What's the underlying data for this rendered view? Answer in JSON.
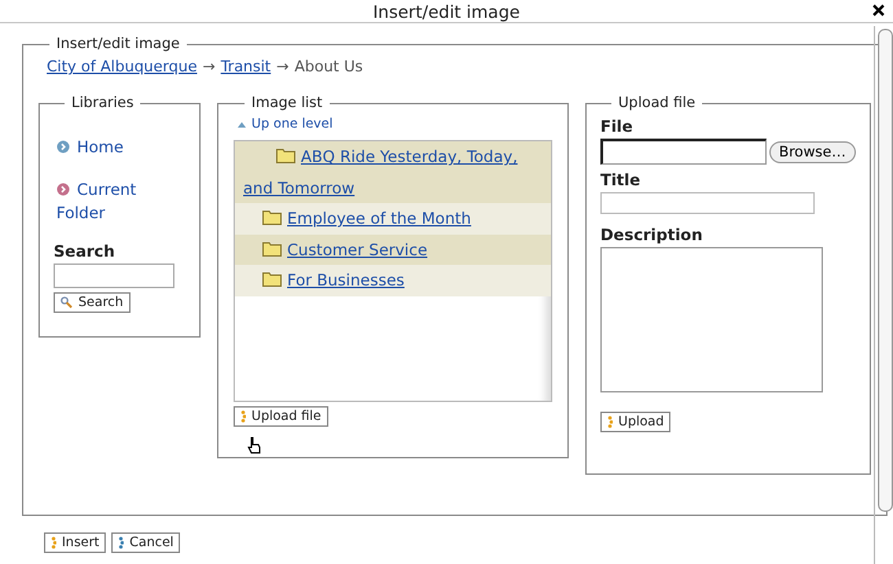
{
  "window": {
    "title": "Insert/edit image"
  },
  "form": {
    "legend": "Insert/edit image",
    "breadcrumb": [
      {
        "label": "City of Albuquerque",
        "kind": "link"
      },
      {
        "label": "Transit",
        "kind": "link",
        "separator": "→"
      },
      {
        "label": "About Us",
        "kind": "current",
        "separator": "→"
      }
    ]
  },
  "libraries": {
    "legend": "Libraries",
    "items": [
      {
        "label": "Home",
        "color": "#6f9fc2"
      },
      {
        "label": "Current Folder",
        "color": "#c4708c"
      }
    ],
    "search_label": "Search",
    "search_button": "Search"
  },
  "image_list": {
    "legend": "Image list",
    "up_link": "Up one level",
    "folders": [
      {
        "label": "ABQ Ride Yesterday, Today, and Tomorrow"
      },
      {
        "label": "Employee of the Month"
      },
      {
        "label": "Customer Service"
      },
      {
        "label": "For Businesses"
      }
    ],
    "upload_button": "Upload file"
  },
  "upload": {
    "legend": "Upload file",
    "fields": [
      {
        "label": "File",
        "kind": "file",
        "button": "Browse…"
      },
      {
        "label": "Title",
        "kind": "text"
      },
      {
        "label": "Description",
        "kind": "textarea"
      }
    ],
    "submit": "Upload"
  },
  "buttons": [
    {
      "label": "Insert",
      "kind": "primary"
    },
    {
      "label": "Cancel",
      "kind": "secondary"
    }
  ]
}
